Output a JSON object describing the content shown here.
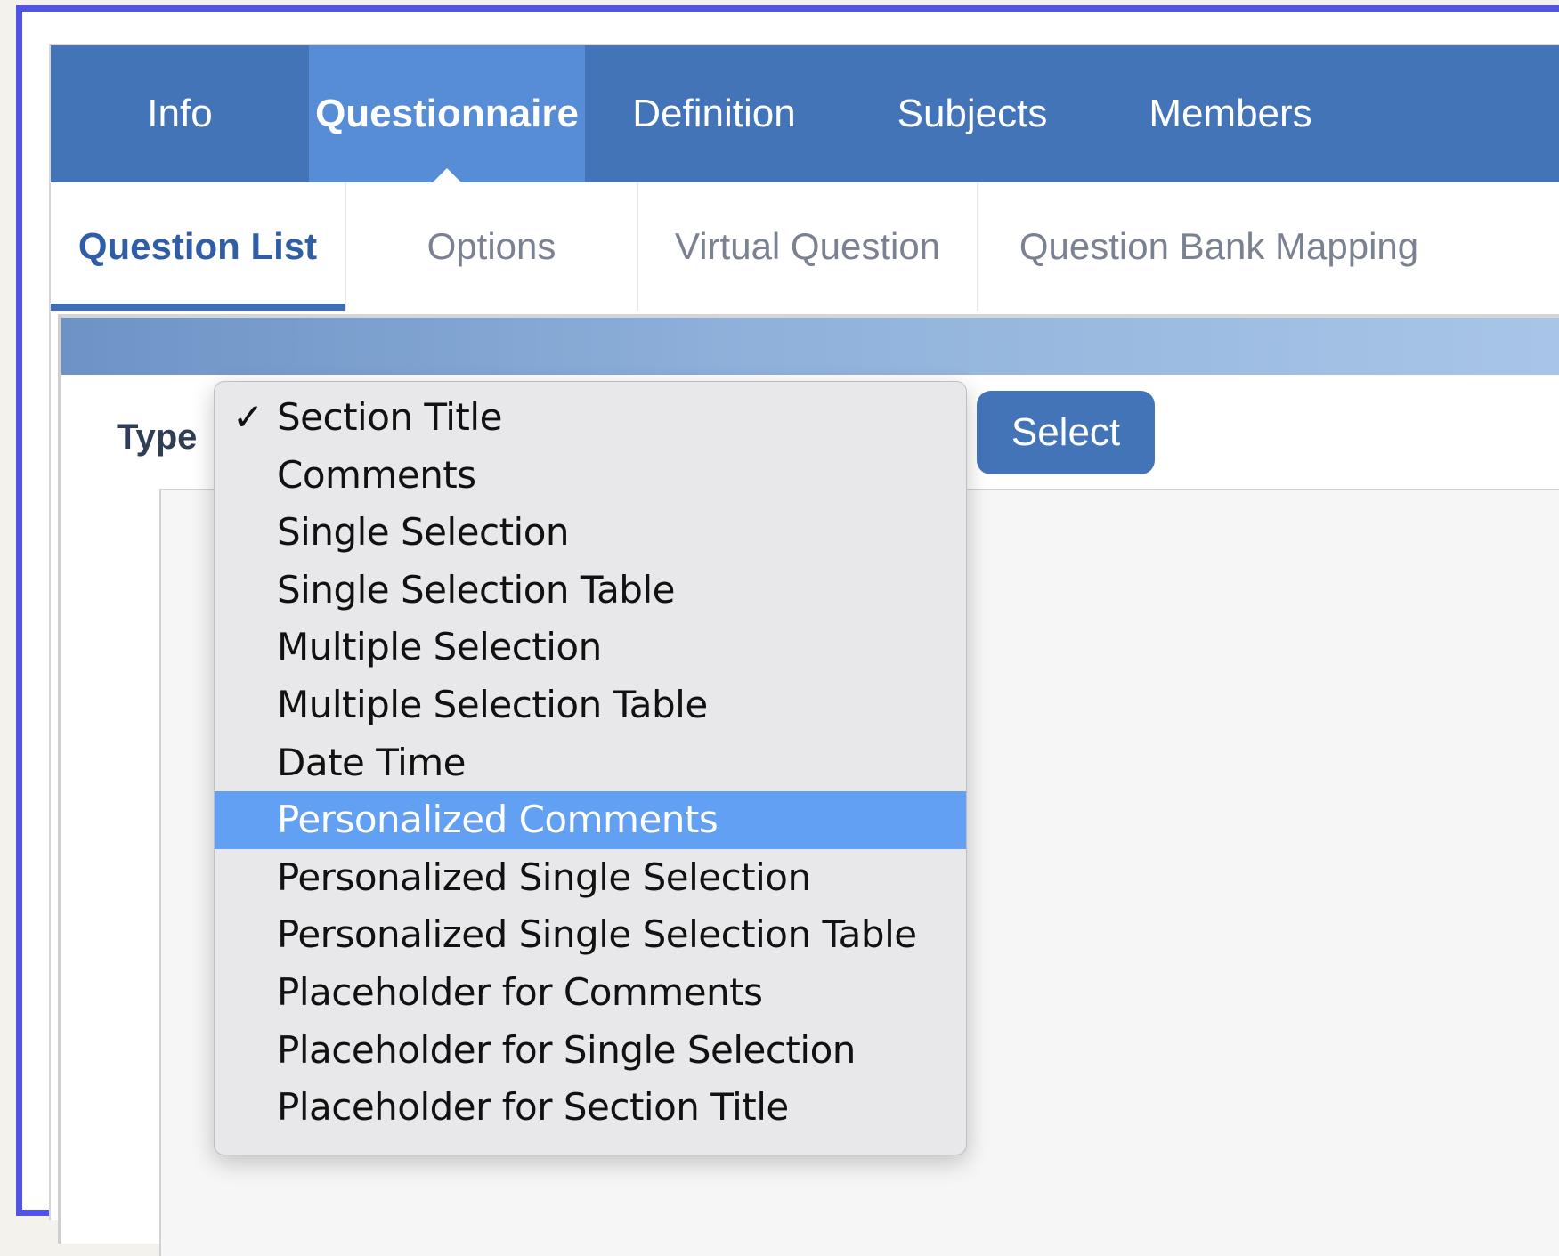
{
  "main_tabs": [
    {
      "label": "Info",
      "active": false
    },
    {
      "label": "Questionnaire",
      "active": true
    },
    {
      "label": "Definition",
      "active": false
    },
    {
      "label": "Subjects",
      "active": false
    },
    {
      "label": "Members",
      "active": false
    }
  ],
  "sub_tabs": [
    {
      "label": "Question List",
      "active": true
    },
    {
      "label": "Options",
      "active": false
    },
    {
      "label": "Virtual Question",
      "active": false
    },
    {
      "label": "Question Bank Mapping",
      "active": false
    }
  ],
  "filter": {
    "type_label": "Type",
    "select_button": "Select"
  },
  "type_dropdown": {
    "selected": "Section Title",
    "highlighted": "Personalized Comments",
    "check_glyph": "✓",
    "options": [
      "Section Title",
      "Comments",
      "Single Selection",
      "Single Selection Table",
      "Multiple Selection",
      "Multiple Selection Table",
      "Date Time",
      "Personalized Comments",
      "Personalized Single Selection",
      "Personalized Single Selection Table",
      "Placeholder for Comments",
      "Placeholder for Single Selection",
      "Placeholder for Section Title"
    ]
  },
  "colors": {
    "frame_border": "#5054e6",
    "tab_bar": "#4474b8",
    "tab_active": "#578dd7",
    "highlight": "#62a0f4"
  }
}
